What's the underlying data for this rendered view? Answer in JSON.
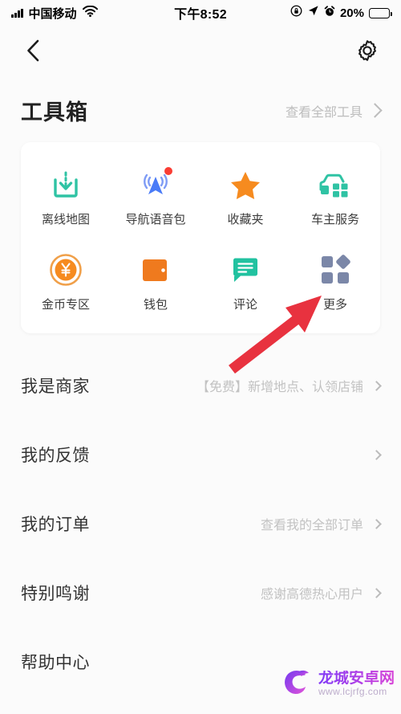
{
  "status_bar": {
    "signal_icon": "signal-bars-icon",
    "carrier": "中国移动",
    "wifi_icon": "wifi-icon",
    "time": "下午8:52",
    "rotation_lock_icon": "rotation-lock-icon",
    "location_icon": "location-arrow-icon",
    "alarm_icon": "alarm-clock-icon",
    "battery_percent": "20%",
    "battery_level": 20,
    "battery_color": "#f5222d"
  },
  "navbar": {
    "back_icon": "chevron-left-icon",
    "settings_icon": "gear-icon"
  },
  "toolbox": {
    "title": "工具箱",
    "see_all_label": "查看全部工具",
    "see_all_chevron": "chevron-right-icon",
    "tools": [
      {
        "label": "离线地图",
        "icon": "offline-map-download-icon",
        "color": "#2fc3a4",
        "badge": false
      },
      {
        "label": "导航语音包",
        "icon": "navigation-voice-icon",
        "color": "#4a7bf7",
        "badge": true
      },
      {
        "label": "收藏夹",
        "icon": "star-favorites-icon",
        "color": "#f68b1f",
        "badge": false
      },
      {
        "label": "车主服务",
        "icon": "car-service-icon",
        "color": "#2fc3a4",
        "badge": false
      },
      {
        "label": "金币专区",
        "icon": "gold-coin-icon",
        "color": "#f68b1f",
        "badge": false
      },
      {
        "label": "钱包",
        "icon": "wallet-icon",
        "color": "#ef7a1e",
        "badge": false
      },
      {
        "label": "评论",
        "icon": "comment-bubble-icon",
        "color": "#21c2a0",
        "badge": false
      },
      {
        "label": "更多",
        "icon": "more-grid-icon",
        "color": "#7b87a8",
        "badge": false
      }
    ]
  },
  "list": {
    "rows": [
      {
        "title": "我是商家",
        "subtitle": "【免费】新增地点、认领店铺",
        "chevron": "chevron-right-icon"
      },
      {
        "title": "我的反馈",
        "subtitle": "",
        "chevron": "chevron-right-icon"
      },
      {
        "title": "我的订单",
        "subtitle": "查看我的全部订单",
        "chevron": "chevron-right-icon"
      },
      {
        "title": "特别鸣谢",
        "subtitle": "感谢高德热心用户",
        "chevron": "chevron-right-icon"
      },
      {
        "title": "帮助中心",
        "subtitle": "",
        "chevron": "chevron-right-icon"
      }
    ]
  },
  "annotation": {
    "arrow_icon": "red-pointer-arrow",
    "arrow_color": "#e8323f",
    "points_to": "更多"
  },
  "watermark": {
    "logo_icon": "dragon-c-logo",
    "site_name": "龙城安卓网",
    "site_url": "www.lcjrfg.com"
  }
}
